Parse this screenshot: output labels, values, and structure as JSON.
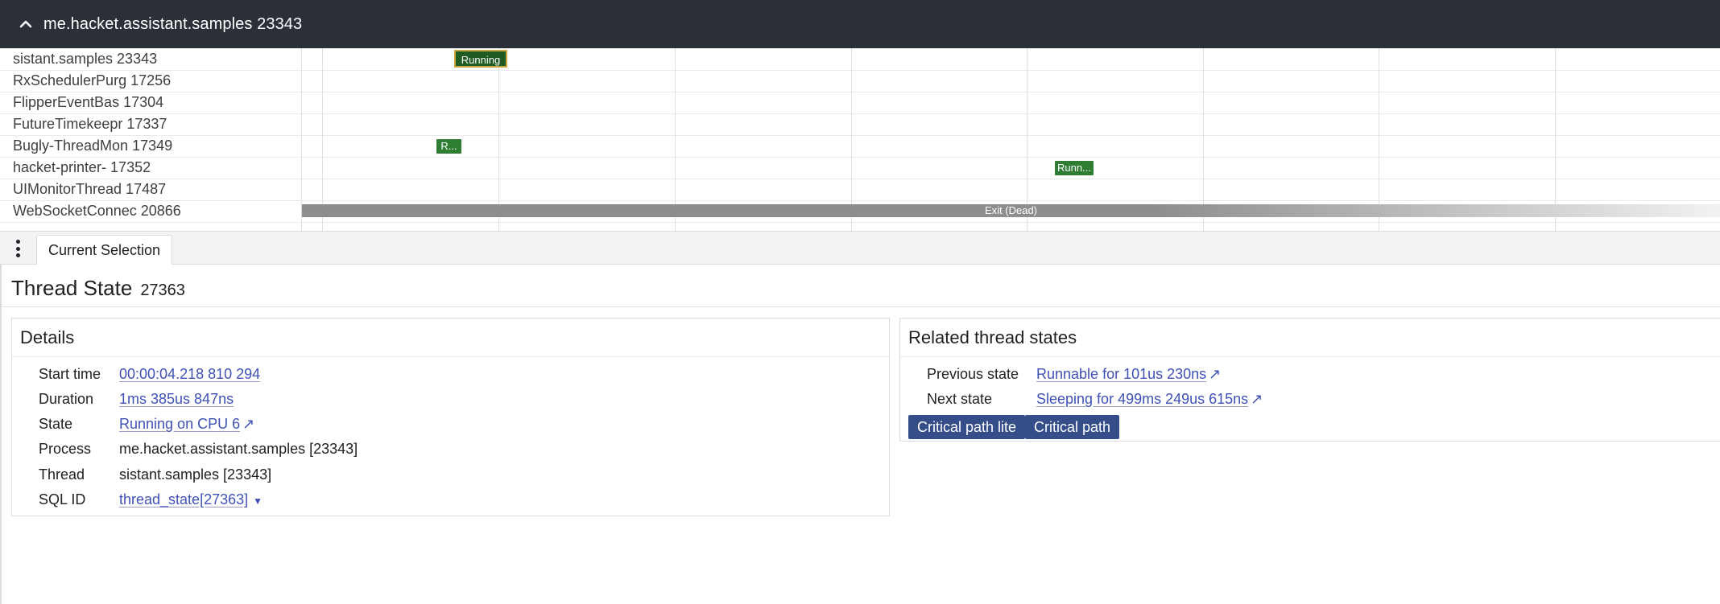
{
  "header": {
    "title": "me.hacket.assistant.samples 23343"
  },
  "tracks": {
    "rows": [
      "sistant.samples 23343",
      "RxSchedulerPurg 17256",
      "FlipperEventBas 17304",
      "FutureTimekeepr 17337",
      "Bugly-ThreadMon 17349",
      "hacket-printer- 17352",
      "UIMonitorThread 17487",
      "WebSocketConnec 20866"
    ],
    "slices": {
      "selected_running": "Running",
      "bugly_running": "R...",
      "printer_running": "Runn...",
      "websocket_exit": "Exit (Dead)"
    }
  },
  "tabs": {
    "current": "Current Selection"
  },
  "details_panel": {
    "title": "Thread State",
    "id": "27363",
    "details": {
      "heading": "Details",
      "start_time_label": "Start time",
      "start_time_value": "00:00:04.218 810 294",
      "duration_label": "Duration",
      "duration_value": "1ms 385us 847ns",
      "state_label": "State",
      "state_value": "Running on CPU 6",
      "process_label": "Process",
      "process_value": "me.hacket.assistant.samples [23343]",
      "thread_label": "Thread",
      "thread_value": "sistant.samples [23343]",
      "sqlid_label": "SQL ID",
      "sqlid_value": "thread_state[27363]"
    },
    "related": {
      "heading": "Related thread states",
      "previous_label": "Previous state",
      "previous_value": "Runnable for 101us 230ns",
      "next_label": "Next state",
      "next_value": "Sleeping for 499ms 249us 615ns",
      "critical_path_lite": "Critical path lite",
      "critical_path": "Critical path"
    }
  },
  "colors": {
    "header_bg": "#2b2f38",
    "running_slice": "#2e7d32",
    "selected_slice": "#1f5b22",
    "link": "#3f51b5",
    "button": "#354e8a"
  }
}
